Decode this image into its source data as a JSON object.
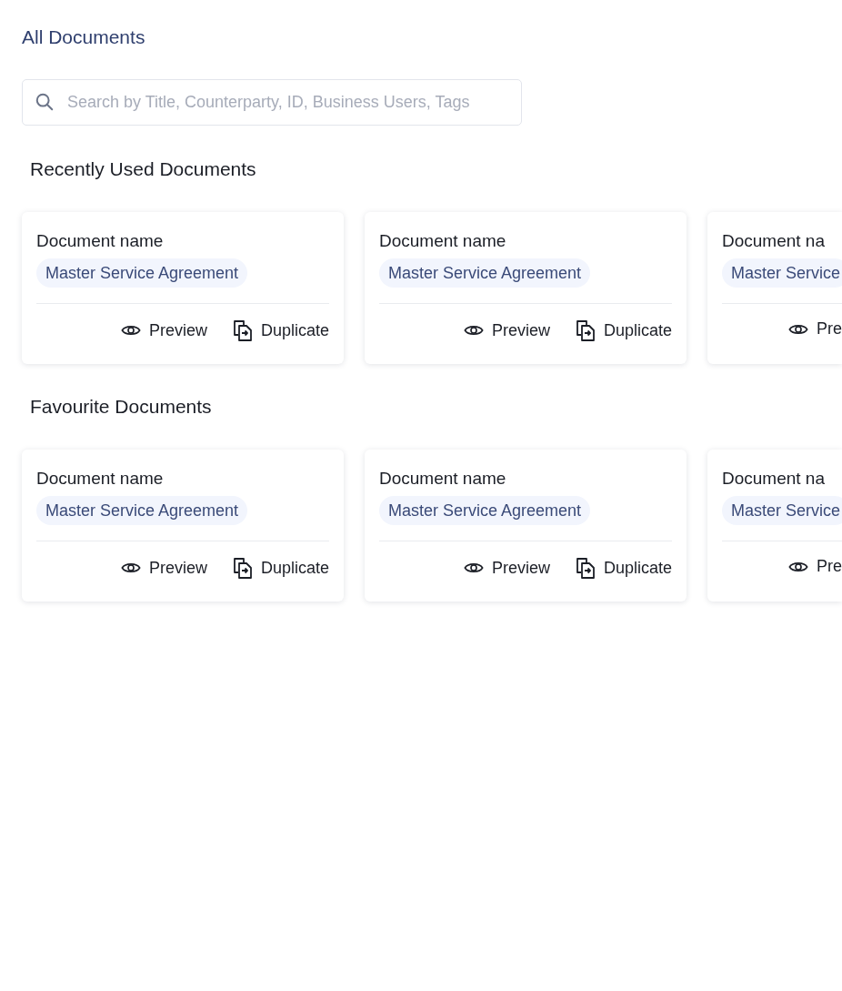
{
  "title": "All Documents",
  "search": {
    "placeholder": "Search by Title, Counterparty, ID, Business Users, Tags"
  },
  "sections": [
    {
      "title": "Recently Used Documents",
      "cards": [
        {
          "name": "Document name",
          "tag": "Master Service Agreement",
          "actions": [
            {
              "kind": "preview",
              "label": "Preview"
            },
            {
              "kind": "duplicate",
              "label": "Duplicate"
            }
          ]
        },
        {
          "name": "Document name",
          "tag": "Master Service Agreement",
          "actions": [
            {
              "kind": "preview",
              "label": "Preview"
            },
            {
              "kind": "duplicate",
              "label": "Duplicate"
            }
          ]
        },
        {
          "name": "Document na",
          "tag": "Master Service",
          "actions": [
            {
              "kind": "preview",
              "label": "Pre"
            }
          ]
        }
      ]
    },
    {
      "title": "Favourite Documents",
      "cards": [
        {
          "name": "Document name",
          "tag": "Master Service Agreement",
          "actions": [
            {
              "kind": "preview",
              "label": "Preview"
            },
            {
              "kind": "duplicate",
              "label": "Duplicate"
            }
          ]
        },
        {
          "name": "Document name",
          "tag": "Master Service Agreement",
          "actions": [
            {
              "kind": "preview",
              "label": "Preview"
            },
            {
              "kind": "duplicate",
              "label": "Duplicate"
            }
          ]
        },
        {
          "name": "Document na",
          "tag": "Master Service",
          "actions": [
            {
              "kind": "preview",
              "label": "Pre"
            }
          ]
        }
      ]
    }
  ]
}
